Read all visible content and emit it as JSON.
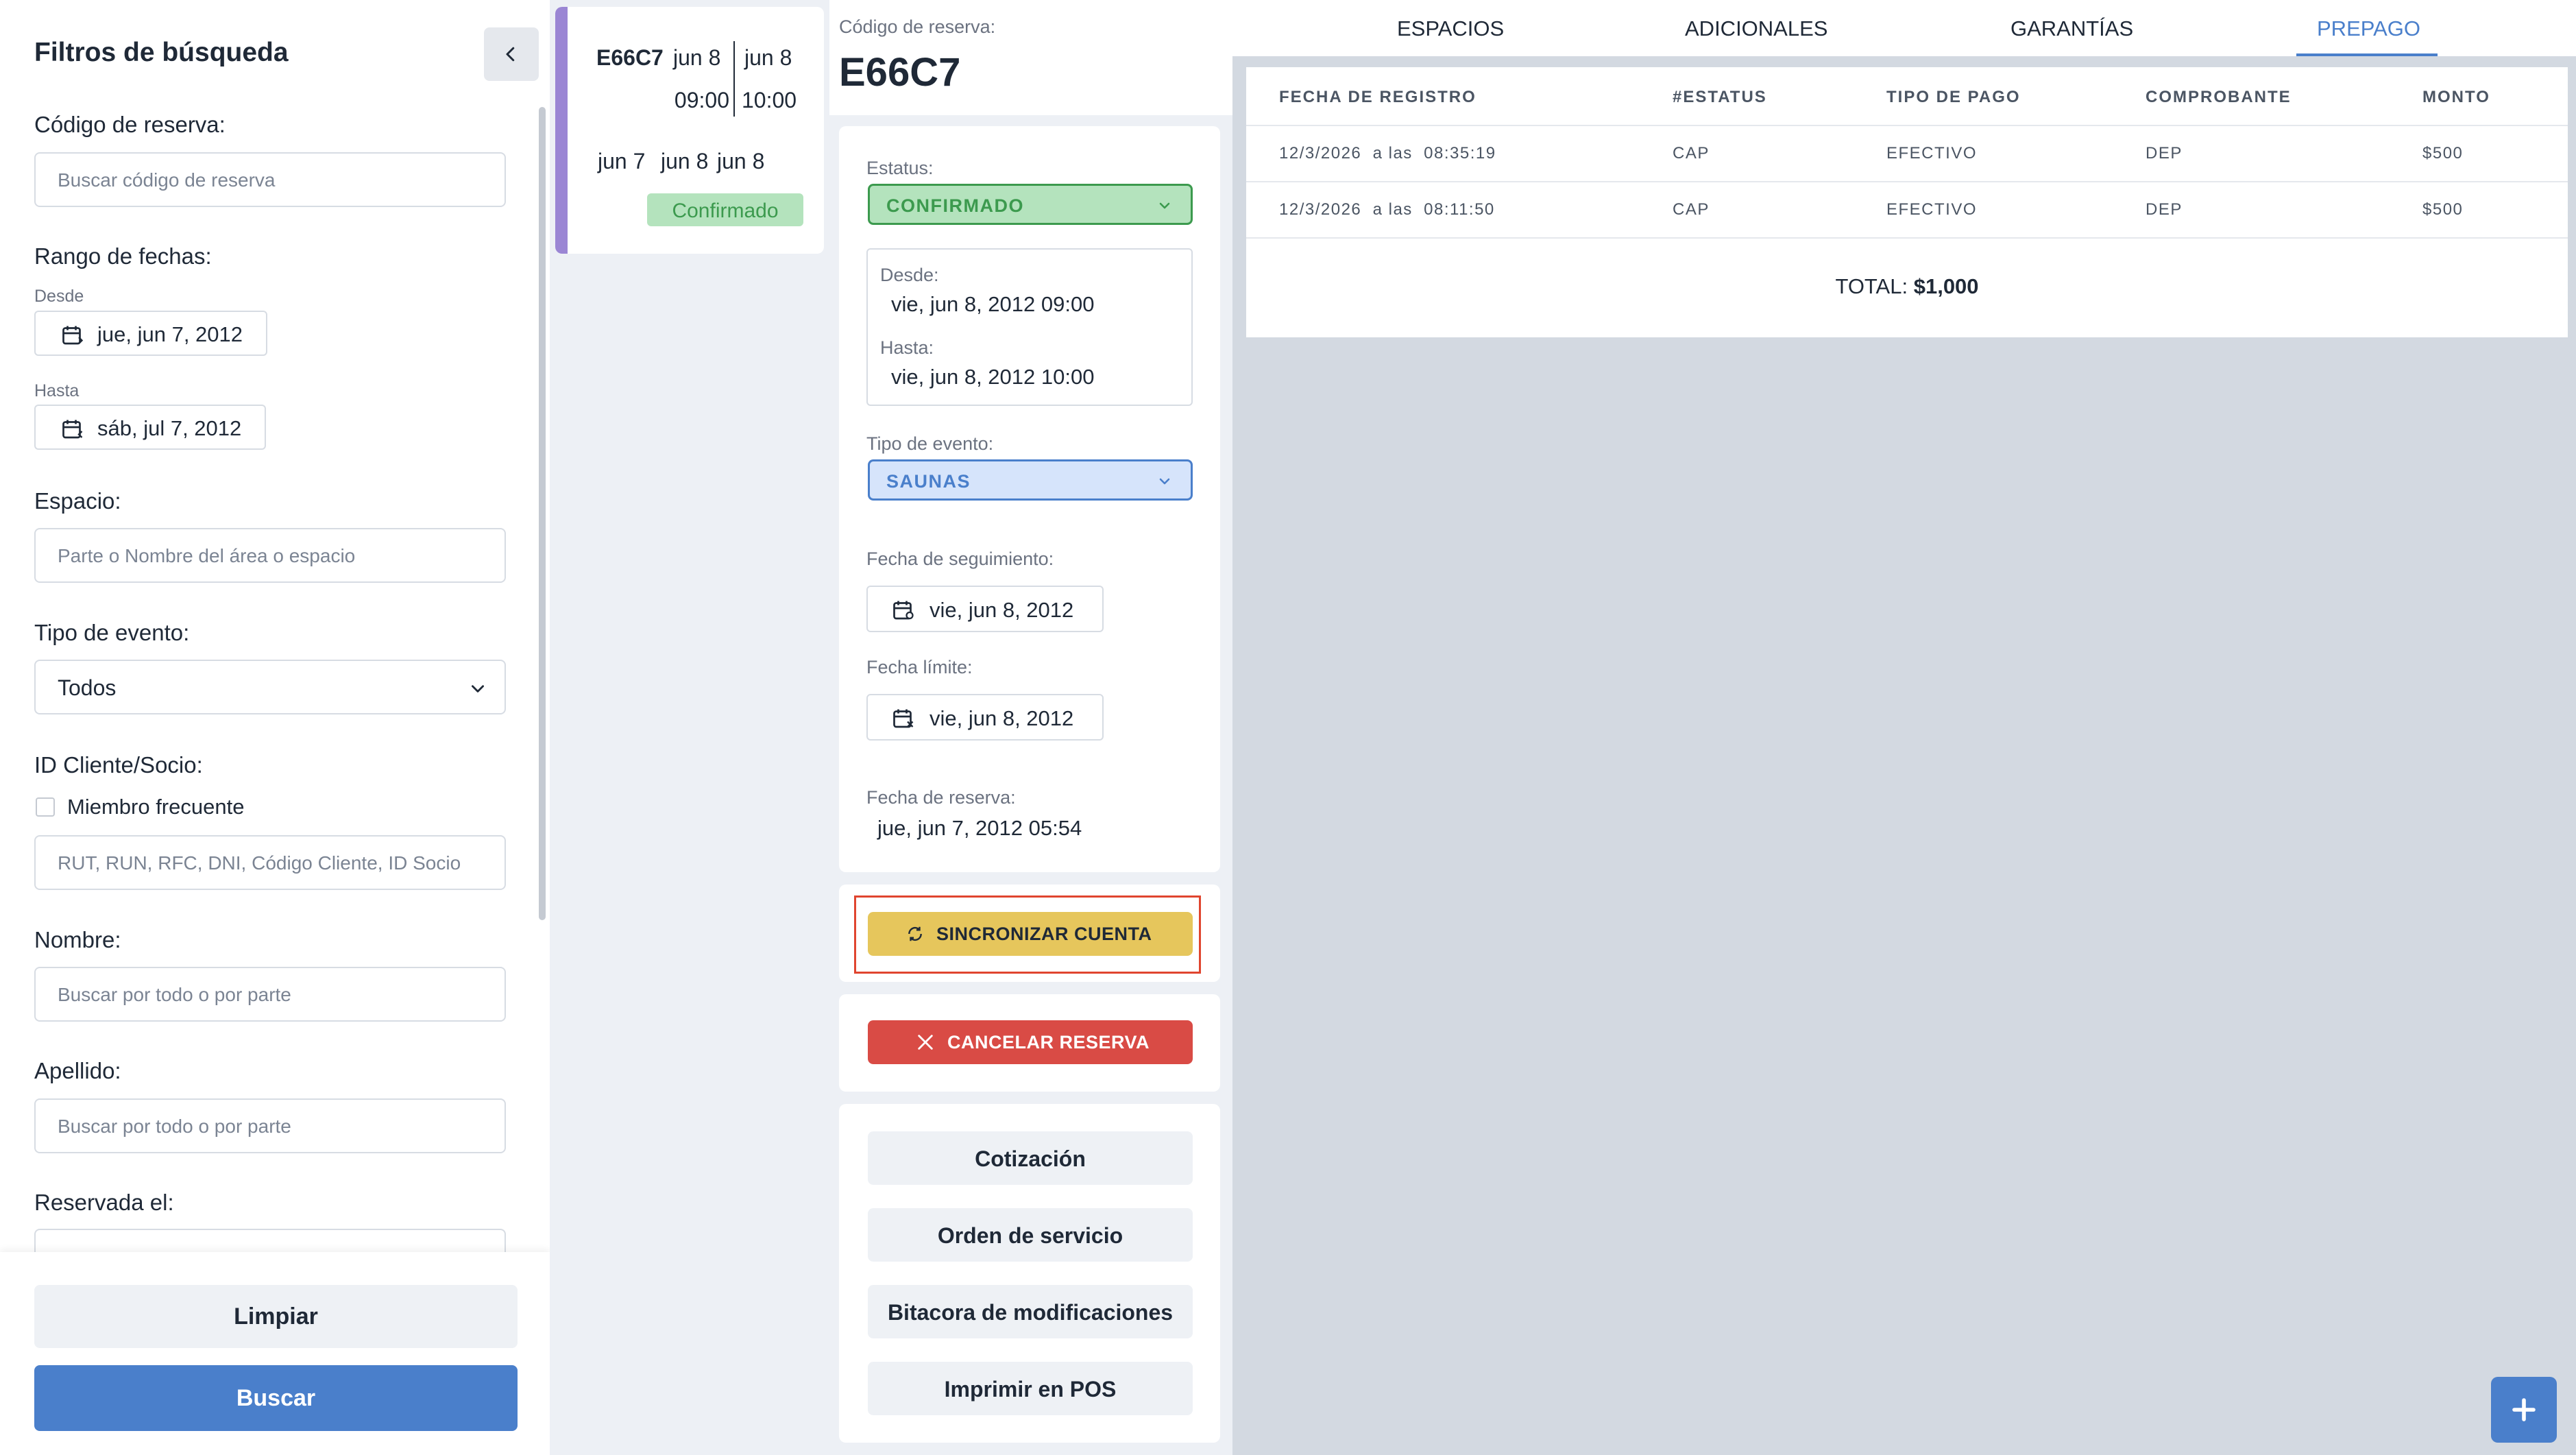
{
  "filters": {
    "title": "Filtros de búsqueda",
    "code_label": "Código de reserva:",
    "code_placeholder": "Buscar código de reserva",
    "range_label": "Rango de fechas:",
    "from_label": "Desde",
    "from_value": "jue, jun 7, 2012",
    "to_label": "Hasta",
    "to_value": "sáb, jul 7, 2012",
    "space_label": "Espacio:",
    "space_placeholder": "Parte o Nombre del área o espacio",
    "event_type_label": "Tipo de evento:",
    "event_type_value": "Todos",
    "client_label": "ID Cliente/Socio:",
    "frequent_label": "Miembro frecuente",
    "client_placeholder": "RUT, RUN, RFC, DNI, Código Cliente, ID Socio",
    "name_label": "Nombre:",
    "name_placeholder": "Buscar por todo o por parte",
    "lastname_label": "Apellido:",
    "lastname_placeholder": "Buscar por todo o por parte",
    "reserved_label": "Reservada el:",
    "clear_button": "Limpiar",
    "search_button": "Buscar"
  },
  "booking_card": {
    "code": "E66C7",
    "start_day": "jun 8",
    "end_day": "jun 8",
    "start_time": "09:00",
    "end_time": "10:00",
    "date_a": "jun 7",
    "date_b": "jun 8",
    "date_c": "jun 8",
    "status": "Confirmado"
  },
  "detail": {
    "code_label": "Código de reserva:",
    "code": "E66C7",
    "status_label": "Estatus:",
    "status_value": "CONFIRMADO",
    "from_label": "Desde:",
    "from_value": "vie, jun 8, 2012 09:00",
    "to_label": "Hasta:",
    "to_value": "vie, jun 8, 2012 10:00",
    "event_type_label": "Tipo de evento:",
    "event_type_value": "SAUNAS",
    "followup_label": "Fecha de seguimiento:",
    "followup_value": "vie, jun 8, 2012",
    "deadline_label": "Fecha límite:",
    "deadline_value": "vie, jun 8, 2012",
    "reserve_date_label": "Fecha de reserva:",
    "reserve_date_value": "jue, jun 7, 2012 05:54",
    "sync_button": "SINCRONIZAR CUENTA",
    "cancel_button": "CANCELAR RESERVA",
    "quote_button": "Cotización",
    "service_order_button": "Orden de servicio",
    "log_button": "Bitacora de modificaciones",
    "print_button": "Imprimir en POS"
  },
  "tabs": [
    "ESPACIOS",
    "ADICIONALES",
    "GARANTÍAS",
    "PREPAGO"
  ],
  "active_tab": "PREPAGO",
  "prepago_table": {
    "headers": [
      "FECHA DE REGISTRO",
      "#ESTATUS",
      "TIPO DE PAGO",
      "COMPROBANTE",
      "MONTO"
    ],
    "rows": [
      [
        "12/3/2026  a las  08:35:19",
        "CAP",
        "EFECTIVO",
        "DEP",
        "$500"
      ],
      [
        "12/3/2026  a las  08:11:50",
        "CAP",
        "EFECTIVO",
        "DEP",
        "$500"
      ]
    ],
    "total_label": "TOTAL:",
    "total_value": "$1,000"
  },
  "colors": {
    "primary": "#4a7fcb",
    "success_bg": "#b4e3bd",
    "success_text": "#3c9a4e",
    "info_bg": "#d6e4fb",
    "warning": "#e6c65c",
    "danger": "#d94b45",
    "accent_bar": "#9b86d4",
    "highlight_border": "#e0452f"
  },
  "icons": {
    "back": "chevron-left-icon",
    "calendar": "calendar-icon",
    "sync": "sync-icon",
    "cancel": "close-icon",
    "fab": "plus-icon"
  }
}
